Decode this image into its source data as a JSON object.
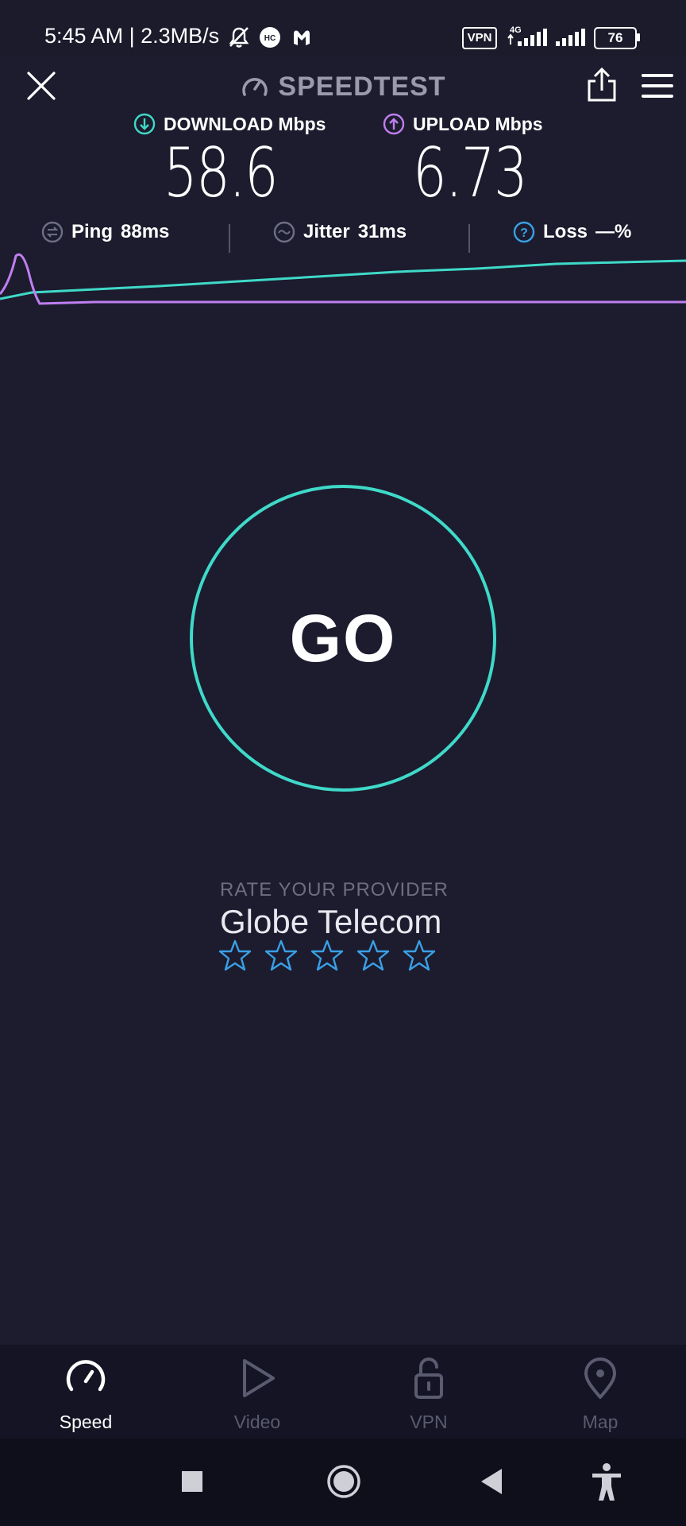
{
  "status_bar": {
    "time": "5:45 AM | 2.3MB/s",
    "vpn": "VPN",
    "network": "4G",
    "battery": "76"
  },
  "header": {
    "title": "SPEEDTEST"
  },
  "download": {
    "label": "DOWNLOAD Mbps",
    "value": "58.6",
    "color": "#3fd9c9"
  },
  "upload": {
    "label": "UPLOAD Mbps",
    "value": "6.73",
    "color": "#c07ef0"
  },
  "stats": {
    "ping_label": "Ping",
    "ping_value": "88ms",
    "jitter_label": "Jitter",
    "jitter_value": "31ms",
    "loss_label": "Loss",
    "loss_value": "—%"
  },
  "go_button": {
    "label": "GO"
  },
  "rating": {
    "caption": "RATE YOUR PROVIDER",
    "provider": "Globe Telecom",
    "stars_total": 5,
    "stars_filled": 0
  },
  "bottom_nav": {
    "items": [
      {
        "label": "Speed",
        "icon": "speedometer-icon",
        "active": true
      },
      {
        "label": "Video",
        "icon": "play-icon",
        "active": false
      },
      {
        "label": "VPN",
        "icon": "unlock-icon",
        "active": false
      },
      {
        "label": "Map",
        "icon": "map-pin-icon",
        "active": false
      }
    ]
  },
  "colors": {
    "background": "#1c1c2e",
    "accent_teal": "#3fd9c9",
    "accent_purple": "#c07ef0",
    "star_blue": "#3aa0e6"
  }
}
